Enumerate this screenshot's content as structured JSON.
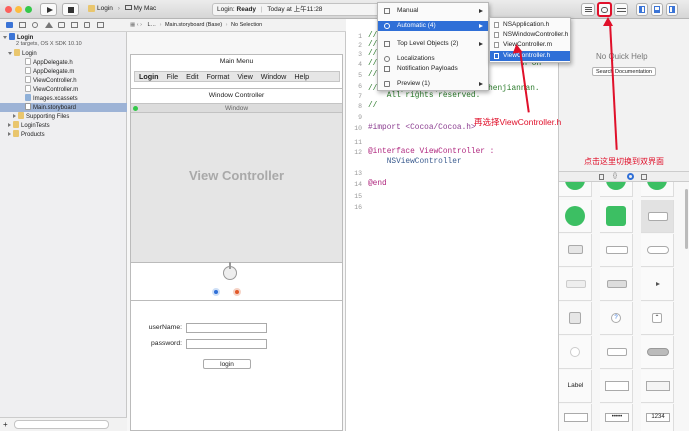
{
  "toolbar": {
    "scheme": "Login",
    "destination": "My Mac",
    "status_app": "Login:",
    "status_state": "Ready",
    "status_time": "Today at 上午11:28"
  },
  "navigator": {
    "project": "Login",
    "project_sub": "2 targets, OS X SDK 10.10",
    "items": [
      {
        "label": "Login",
        "kind": "folder"
      },
      {
        "label": "AppDelegate.h",
        "kind": "h"
      },
      {
        "label": "AppDelegate.m",
        "kind": "m"
      },
      {
        "label": "ViewController.h",
        "kind": "h"
      },
      {
        "label": "ViewController.m",
        "kind": "m"
      },
      {
        "label": "Images.xcassets",
        "kind": "asset"
      },
      {
        "label": "Main.storyboard",
        "kind": "storyboard"
      },
      {
        "label": "Supporting Files",
        "kind": "folder"
      },
      {
        "label": "LoginTests",
        "kind": "folder"
      },
      {
        "label": "Products",
        "kind": "folder"
      }
    ]
  },
  "ib": {
    "jump_left": "L…",
    "jump_file": "Main.storyboard (Base)",
    "jump_right": "No Selection",
    "main_menu_title": "Main Menu",
    "menu_items": [
      "Login",
      "File",
      "Edit",
      "Format",
      "View",
      "Window",
      "Help"
    ],
    "window_controller": "Window Controller",
    "window_title": "Window",
    "view_controller": "View Controller",
    "username_label": "userName:",
    "password_label": "password:",
    "login_button": "login"
  },
  "editor": {
    "lines": [
      {
        "n": "1",
        "text": "//"
      },
      {
        "n": "2",
        "text": "//"
      },
      {
        "n": "3",
        "text": "//"
      },
      {
        "n": "4",
        "text": "//                               n on"
      },
      {
        "n": "5",
        "text": "//"
      },
      {
        "n": "6",
        "text": "//  Copyright (c) 2015年 chenjiannan."
      },
      {
        "n": "7",
        "text": "    All rights reserved."
      },
      {
        "n": "8",
        "text": "//"
      },
      {
        "n": "9",
        "text": ""
      },
      {
        "n": "10",
        "text": "#import <Cocoa/Cocoa.h>"
      },
      {
        "n": "11",
        "text": ""
      },
      {
        "n": "12",
        "text": "@interface ViewController :"
      },
      {
        "n": "",
        "text": "    NSViewController"
      },
      {
        "n": "13",
        "text": ""
      },
      {
        "n": "14",
        "text": "@end"
      },
      {
        "n": "15",
        "text": ""
      },
      {
        "n": "16",
        "text": ""
      }
    ]
  },
  "popup": {
    "items": [
      {
        "label": "Manual"
      },
      {
        "label": "Automatic (4)"
      },
      {
        "label": "Top Level Objects (2)"
      },
      {
        "label": "Localizations"
      },
      {
        "label": "Notification Payloads"
      },
      {
        "label": "Preview (1)"
      }
    ],
    "sub_items": [
      {
        "label": "NSApplication.h"
      },
      {
        "label": "NSWindowController.h"
      },
      {
        "label": "ViewController.m"
      },
      {
        "label": "ViewController.h"
      }
    ]
  },
  "inspector": {
    "no_quick_help": "No Quick Help",
    "search_docs": "Search Documentation",
    "lib_label": "Label",
    "lib_secure": "•••••",
    "lib_number": "1234"
  },
  "annotations": {
    "select_note": "再选择ViewController.h",
    "switch_note": "点击这里切换到双界面"
  },
  "colors": {
    "highlight": "#2f6fd7",
    "annotation": "#e0102a",
    "library_green": "#3cbf63"
  }
}
